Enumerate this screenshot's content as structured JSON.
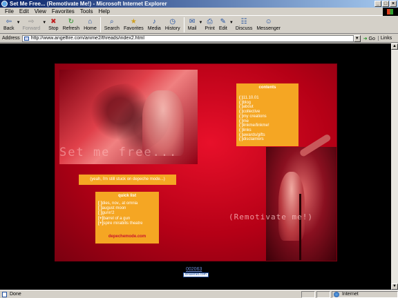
{
  "window": {
    "title": "Set Me Free... (Remotivate Me!) - Microsoft Internet Explorer"
  },
  "menubar": {
    "items": [
      "File",
      "Edit",
      "View",
      "Favorites",
      "Tools",
      "Help"
    ]
  },
  "toolbar": {
    "back": "Back",
    "forward": "Forward",
    "stop": "Stop",
    "refresh": "Refresh",
    "home": "Home",
    "search": "Search",
    "favorites": "Favorites",
    "media": "Media",
    "history": "History",
    "mail": "Mail",
    "print": "Print",
    "edit": "Edit",
    "discuss": "Discuss",
    "messenger": "Messenger"
  },
  "addressbar": {
    "label": "Address",
    "url": "http://www.angelfire.com/anime2/threads/index2.html",
    "go": "Go",
    "links": "Links"
  },
  "site": {
    "title": "Set me free...",
    "slogan": "(Remotivate me!)",
    "tagline": "(yeah, i'm still stuck on depeche mode...)",
    "contents": {
      "heading": "contents",
      "items": [
        "11.10.01",
        "blog",
        "about",
        "collective",
        "my creations",
        "me",
        "linkme/linkme!",
        "links",
        "awards/gifts",
        "disclaimers"
      ]
    },
    "quicklist": {
      "heading": "quick list",
      "items": [
        {
          "mark": "[ ]",
          "text": "dies, nov., at omnia"
        },
        {
          "mark": "[ ]",
          "text": "august moon"
        },
        {
          "mark": "[ ]",
          "text": "gunn'2"
        },
        {
          "mark": "[+]",
          "text": "barrel of a gun"
        },
        {
          "mark": "[+]",
          "text": "spire mirabilis theatre"
        }
      ],
      "link": "depechemode.com"
    },
    "counter": "002063",
    "counter_badge": "Bravenet.com"
  },
  "statusbar": {
    "status": "Done",
    "zone": "Internet"
  }
}
